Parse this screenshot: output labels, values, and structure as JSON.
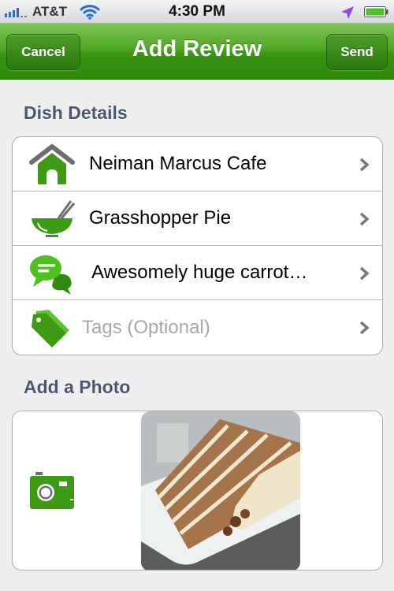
{
  "status_bar": {
    "carrier": "AT&T",
    "time": "4:30 PM",
    "signal_icon": "signal-bars-icon",
    "wifi_icon": "wifi-icon",
    "location_icon": "location-arrow-icon",
    "battery_icon": "battery-icon"
  },
  "nav_bar": {
    "title": "Add Review",
    "left_button": "Cancel",
    "right_button": "Send",
    "color": "#3a9512"
  },
  "dish_details": {
    "header": "Dish Details",
    "rows": [
      {
        "icon": "home-icon",
        "label": "Neiman Marcus Cafe",
        "placeholder": false
      },
      {
        "icon": "bowl-chopsticks-icon",
        "label": "Grasshopper Pie",
        "placeholder": false
      },
      {
        "icon": "speech-bubbles-icon",
        "label": "Awesomely huge carrot…",
        "placeholder": false
      },
      {
        "icon": "tag-icon",
        "label": "Tags (Optional)",
        "placeholder": true
      }
    ]
  },
  "photo_section": {
    "header": "Add a Photo",
    "camera_icon": "camera-icon",
    "photo_description": "Slice of layered carrot cake with cream cheese frosting on a white plate"
  },
  "colors": {
    "accent_green": "#3a9512",
    "icon_green": "#3c9a14",
    "section_header": "#4c566c",
    "placeholder_text": "#a8a8a8",
    "chevron": "#7a7a7a"
  }
}
